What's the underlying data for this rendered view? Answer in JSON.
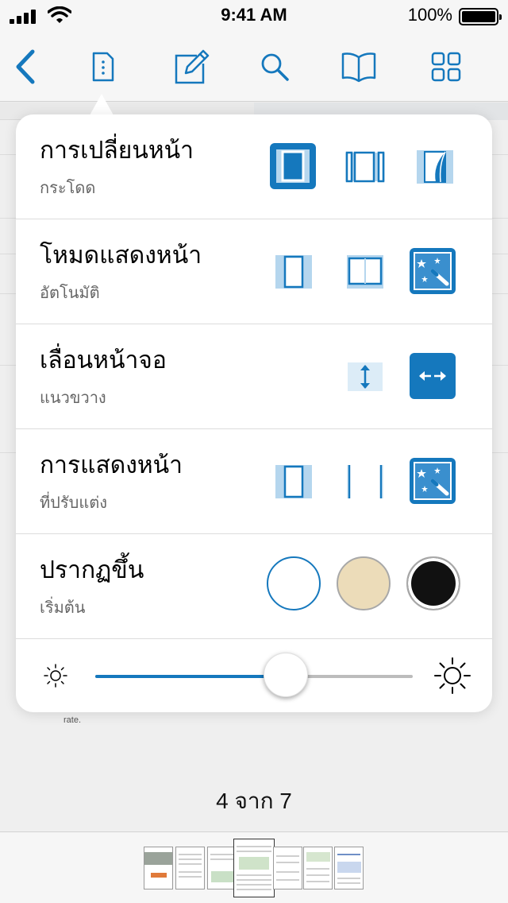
{
  "status_bar": {
    "time": "9:41 AM",
    "battery_percent": "100%"
  },
  "toolbar": {
    "icons": [
      "back-chevron-icon",
      "document-settings-icon",
      "annotate-pencil-icon",
      "search-icon",
      "bookmarks-book-icon",
      "grid-view-icon"
    ],
    "accent_color": "#1578bd"
  },
  "popover": {
    "rows": [
      {
        "title": "การเปลี่ยนหน้า",
        "subtitle": "กระโดด"
      },
      {
        "title": "โหมดแสดงหน้า",
        "subtitle": "อัตโนมัติ"
      },
      {
        "title": "เลื่อนหน้าจอ",
        "subtitle": "แนวขวาง"
      },
      {
        "title": "การแสดงหน้า",
        "subtitle": "ที่ปรับแต่ง"
      },
      {
        "title": "ปรากฏขึ้น",
        "subtitle": "เริ่มต้น"
      }
    ],
    "appearance_colors": [
      "#ffffff",
      "#ecdcb9",
      "#111111"
    ],
    "brightness_fraction": 0.6
  },
  "document": {
    "rate_text": "rate.",
    "page_counter": "4 จาก 7"
  },
  "thumbnails": {
    "count": 7,
    "current_index": 3
  }
}
